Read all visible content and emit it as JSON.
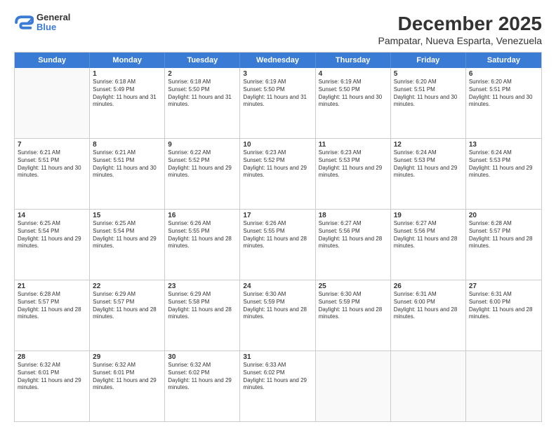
{
  "logo": {
    "line1": "General",
    "line2": "Blue"
  },
  "title": "December 2025",
  "subtitle": "Pampatar, Nueva Esparta, Venezuela",
  "header_days": [
    "Sunday",
    "Monday",
    "Tuesday",
    "Wednesday",
    "Thursday",
    "Friday",
    "Saturday"
  ],
  "weeks": [
    [
      {
        "day": "",
        "empty": true
      },
      {
        "day": "1",
        "sunrise": "6:18 AM",
        "sunset": "5:49 PM",
        "daylight": "11 hours and 31 minutes."
      },
      {
        "day": "2",
        "sunrise": "6:18 AM",
        "sunset": "5:50 PM",
        "daylight": "11 hours and 31 minutes."
      },
      {
        "day": "3",
        "sunrise": "6:19 AM",
        "sunset": "5:50 PM",
        "daylight": "11 hours and 31 minutes."
      },
      {
        "day": "4",
        "sunrise": "6:19 AM",
        "sunset": "5:50 PM",
        "daylight": "11 hours and 30 minutes."
      },
      {
        "day": "5",
        "sunrise": "6:20 AM",
        "sunset": "5:51 PM",
        "daylight": "11 hours and 30 minutes."
      },
      {
        "day": "6",
        "sunrise": "6:20 AM",
        "sunset": "5:51 PM",
        "daylight": "11 hours and 30 minutes."
      }
    ],
    [
      {
        "day": "7",
        "sunrise": "6:21 AM",
        "sunset": "5:51 PM",
        "daylight": "11 hours and 30 minutes."
      },
      {
        "day": "8",
        "sunrise": "6:21 AM",
        "sunset": "5:51 PM",
        "daylight": "11 hours and 30 minutes."
      },
      {
        "day": "9",
        "sunrise": "6:22 AM",
        "sunset": "5:52 PM",
        "daylight": "11 hours and 29 minutes."
      },
      {
        "day": "10",
        "sunrise": "6:23 AM",
        "sunset": "5:52 PM",
        "daylight": "11 hours and 29 minutes."
      },
      {
        "day": "11",
        "sunrise": "6:23 AM",
        "sunset": "5:53 PM",
        "daylight": "11 hours and 29 minutes."
      },
      {
        "day": "12",
        "sunrise": "6:24 AM",
        "sunset": "5:53 PM",
        "daylight": "11 hours and 29 minutes."
      },
      {
        "day": "13",
        "sunrise": "6:24 AM",
        "sunset": "5:53 PM",
        "daylight": "11 hours and 29 minutes."
      }
    ],
    [
      {
        "day": "14",
        "sunrise": "6:25 AM",
        "sunset": "5:54 PM",
        "daylight": "11 hours and 29 minutes."
      },
      {
        "day": "15",
        "sunrise": "6:25 AM",
        "sunset": "5:54 PM",
        "daylight": "11 hours and 29 minutes."
      },
      {
        "day": "16",
        "sunrise": "6:26 AM",
        "sunset": "5:55 PM",
        "daylight": "11 hours and 28 minutes."
      },
      {
        "day": "17",
        "sunrise": "6:26 AM",
        "sunset": "5:55 PM",
        "daylight": "11 hours and 28 minutes."
      },
      {
        "day": "18",
        "sunrise": "6:27 AM",
        "sunset": "5:56 PM",
        "daylight": "11 hours and 28 minutes."
      },
      {
        "day": "19",
        "sunrise": "6:27 AM",
        "sunset": "5:56 PM",
        "daylight": "11 hours and 28 minutes."
      },
      {
        "day": "20",
        "sunrise": "6:28 AM",
        "sunset": "5:57 PM",
        "daylight": "11 hours and 28 minutes."
      }
    ],
    [
      {
        "day": "21",
        "sunrise": "6:28 AM",
        "sunset": "5:57 PM",
        "daylight": "11 hours and 28 minutes."
      },
      {
        "day": "22",
        "sunrise": "6:29 AM",
        "sunset": "5:57 PM",
        "daylight": "11 hours and 28 minutes."
      },
      {
        "day": "23",
        "sunrise": "6:29 AM",
        "sunset": "5:58 PM",
        "daylight": "11 hours and 28 minutes."
      },
      {
        "day": "24",
        "sunrise": "6:30 AM",
        "sunset": "5:59 PM",
        "daylight": "11 hours and 28 minutes."
      },
      {
        "day": "25",
        "sunrise": "6:30 AM",
        "sunset": "5:59 PM",
        "daylight": "11 hours and 28 minutes."
      },
      {
        "day": "26",
        "sunrise": "6:31 AM",
        "sunset": "6:00 PM",
        "daylight": "11 hours and 28 minutes."
      },
      {
        "day": "27",
        "sunrise": "6:31 AM",
        "sunset": "6:00 PM",
        "daylight": "11 hours and 28 minutes."
      }
    ],
    [
      {
        "day": "28",
        "sunrise": "6:32 AM",
        "sunset": "6:01 PM",
        "daylight": "11 hours and 29 minutes."
      },
      {
        "day": "29",
        "sunrise": "6:32 AM",
        "sunset": "6:01 PM",
        "daylight": "11 hours and 29 minutes."
      },
      {
        "day": "30",
        "sunrise": "6:32 AM",
        "sunset": "6:02 PM",
        "daylight": "11 hours and 29 minutes."
      },
      {
        "day": "31",
        "sunrise": "6:33 AM",
        "sunset": "6:02 PM",
        "daylight": "11 hours and 29 minutes."
      },
      {
        "day": "",
        "empty": true
      },
      {
        "day": "",
        "empty": true
      },
      {
        "day": "",
        "empty": true
      }
    ]
  ]
}
